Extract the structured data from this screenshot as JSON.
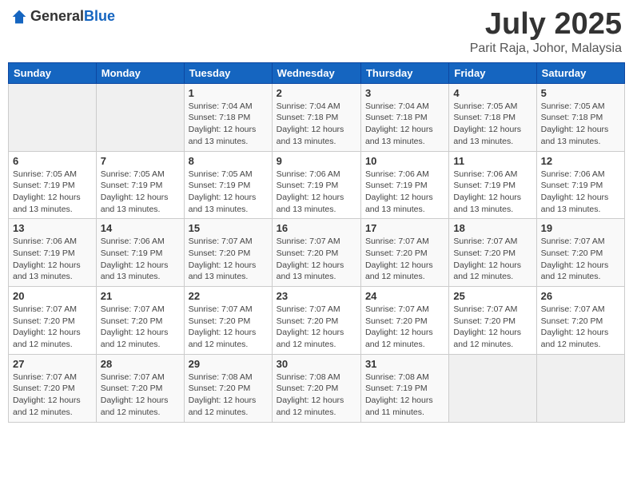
{
  "header": {
    "logo_general": "General",
    "logo_blue": "Blue",
    "month_title": "July 2025",
    "location": "Parit Raja, Johor, Malaysia"
  },
  "weekdays": [
    "Sunday",
    "Monday",
    "Tuesday",
    "Wednesday",
    "Thursday",
    "Friday",
    "Saturday"
  ],
  "weeks": [
    [
      {
        "day": "",
        "empty": true
      },
      {
        "day": "",
        "empty": true
      },
      {
        "day": "1",
        "sunrise": "7:04 AM",
        "sunset": "7:18 PM",
        "daylight": "12 hours and 13 minutes."
      },
      {
        "day": "2",
        "sunrise": "7:04 AM",
        "sunset": "7:18 PM",
        "daylight": "12 hours and 13 minutes."
      },
      {
        "day": "3",
        "sunrise": "7:04 AM",
        "sunset": "7:18 PM",
        "daylight": "12 hours and 13 minutes."
      },
      {
        "day": "4",
        "sunrise": "7:05 AM",
        "sunset": "7:18 PM",
        "daylight": "12 hours and 13 minutes."
      },
      {
        "day": "5",
        "sunrise": "7:05 AM",
        "sunset": "7:18 PM",
        "daylight": "12 hours and 13 minutes."
      }
    ],
    [
      {
        "day": "6",
        "sunrise": "7:05 AM",
        "sunset": "7:19 PM",
        "daylight": "12 hours and 13 minutes."
      },
      {
        "day": "7",
        "sunrise": "7:05 AM",
        "sunset": "7:19 PM",
        "daylight": "12 hours and 13 minutes."
      },
      {
        "day": "8",
        "sunrise": "7:05 AM",
        "sunset": "7:19 PM",
        "daylight": "12 hours and 13 minutes."
      },
      {
        "day": "9",
        "sunrise": "7:06 AM",
        "sunset": "7:19 PM",
        "daylight": "12 hours and 13 minutes."
      },
      {
        "day": "10",
        "sunrise": "7:06 AM",
        "sunset": "7:19 PM",
        "daylight": "12 hours and 13 minutes."
      },
      {
        "day": "11",
        "sunrise": "7:06 AM",
        "sunset": "7:19 PM",
        "daylight": "12 hours and 13 minutes."
      },
      {
        "day": "12",
        "sunrise": "7:06 AM",
        "sunset": "7:19 PM",
        "daylight": "12 hours and 13 minutes."
      }
    ],
    [
      {
        "day": "13",
        "sunrise": "7:06 AM",
        "sunset": "7:19 PM",
        "daylight": "12 hours and 13 minutes."
      },
      {
        "day": "14",
        "sunrise": "7:06 AM",
        "sunset": "7:19 PM",
        "daylight": "12 hours and 13 minutes."
      },
      {
        "day": "15",
        "sunrise": "7:07 AM",
        "sunset": "7:20 PM",
        "daylight": "12 hours and 13 minutes."
      },
      {
        "day": "16",
        "sunrise": "7:07 AM",
        "sunset": "7:20 PM",
        "daylight": "12 hours and 13 minutes."
      },
      {
        "day": "17",
        "sunrise": "7:07 AM",
        "sunset": "7:20 PM",
        "daylight": "12 hours and 12 minutes."
      },
      {
        "day": "18",
        "sunrise": "7:07 AM",
        "sunset": "7:20 PM",
        "daylight": "12 hours and 12 minutes."
      },
      {
        "day": "19",
        "sunrise": "7:07 AM",
        "sunset": "7:20 PM",
        "daylight": "12 hours and 12 minutes."
      }
    ],
    [
      {
        "day": "20",
        "sunrise": "7:07 AM",
        "sunset": "7:20 PM",
        "daylight": "12 hours and 12 minutes."
      },
      {
        "day": "21",
        "sunrise": "7:07 AM",
        "sunset": "7:20 PM",
        "daylight": "12 hours and 12 minutes."
      },
      {
        "day": "22",
        "sunrise": "7:07 AM",
        "sunset": "7:20 PM",
        "daylight": "12 hours and 12 minutes."
      },
      {
        "day": "23",
        "sunrise": "7:07 AM",
        "sunset": "7:20 PM",
        "daylight": "12 hours and 12 minutes."
      },
      {
        "day": "24",
        "sunrise": "7:07 AM",
        "sunset": "7:20 PM",
        "daylight": "12 hours and 12 minutes."
      },
      {
        "day": "25",
        "sunrise": "7:07 AM",
        "sunset": "7:20 PM",
        "daylight": "12 hours and 12 minutes."
      },
      {
        "day": "26",
        "sunrise": "7:07 AM",
        "sunset": "7:20 PM",
        "daylight": "12 hours and 12 minutes."
      }
    ],
    [
      {
        "day": "27",
        "sunrise": "7:07 AM",
        "sunset": "7:20 PM",
        "daylight": "12 hours and 12 minutes."
      },
      {
        "day": "28",
        "sunrise": "7:07 AM",
        "sunset": "7:20 PM",
        "daylight": "12 hours and 12 minutes."
      },
      {
        "day": "29",
        "sunrise": "7:08 AM",
        "sunset": "7:20 PM",
        "daylight": "12 hours and 12 minutes."
      },
      {
        "day": "30",
        "sunrise": "7:08 AM",
        "sunset": "7:20 PM",
        "daylight": "12 hours and 12 minutes."
      },
      {
        "day": "31",
        "sunrise": "7:08 AM",
        "sunset": "7:19 PM",
        "daylight": "12 hours and 11 minutes."
      },
      {
        "day": "",
        "empty": true
      },
      {
        "day": "",
        "empty": true
      }
    ]
  ]
}
